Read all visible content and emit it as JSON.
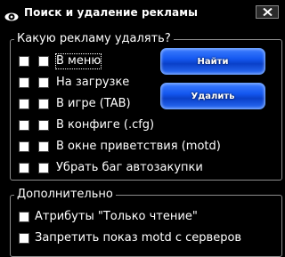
{
  "window": {
    "title": "Поиск и удаление рекламы"
  },
  "icons": {
    "app": "eye-icon",
    "close": "close-icon"
  },
  "which_ads_group": {
    "legend": "Какую рекламу удалять?",
    "options": [
      {
        "label": "В меню",
        "checked": false
      },
      {
        "label": "На загрузке",
        "checked": false
      },
      {
        "label": "В игре (TAB)",
        "checked": false
      },
      {
        "label": "В конфиге (.cfg)",
        "checked": false
      },
      {
        "label": "В окне приветствия (motd)",
        "checked": false
      },
      {
        "label": "Убрать баг автозакупки",
        "checked": false
      }
    ],
    "find_button": "Найти",
    "delete_button": "Удалить"
  },
  "additional_group": {
    "legend": "Дополнительно",
    "options": [
      {
        "label": "Атрибуты \"Только чтение\"",
        "checked": false
      },
      {
        "label": "Запретить показ motd с серверов",
        "checked": false
      }
    ]
  },
  "colors": {
    "background": "#000000",
    "text": "#ffffff",
    "button_blue": "#1458f0"
  }
}
